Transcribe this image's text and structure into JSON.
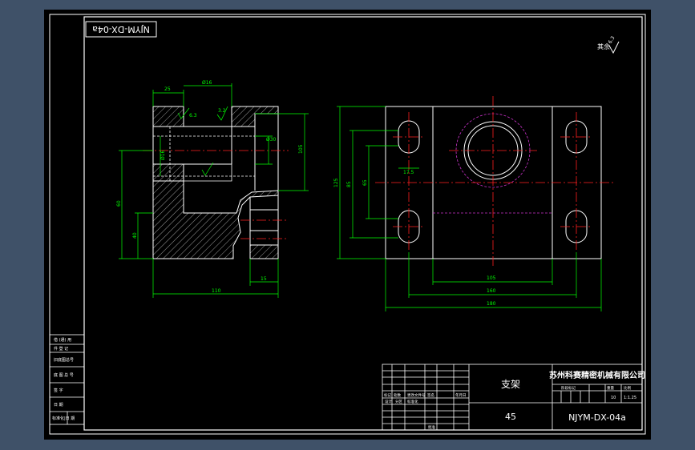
{
  "app": {
    "background_color": "#3f5168",
    "paper_color": "#000000"
  },
  "drawing": {
    "title_code_rotated": "NJYM-DX-04a",
    "roughness_note": "其余",
    "roughness_value": "6.3",
    "part_name": "支架",
    "material": "45",
    "company": "苏州科赛精密机械有限公司",
    "drawing_number": "NJYM-DX-04a",
    "scale_label": "比例",
    "scale": "1:1.25",
    "quantity": "10",
    "weight_label": "重量",
    "stage_label": "阶段标记",
    "sheet_label": "共  张  第  张"
  },
  "side_labels": [
    "借 (通) 用",
    "件 登 记",
    "旧底图总号",
    "底 图 总 号",
    "签  字",
    "日  期",
    "标准化|日 期"
  ],
  "title_block_labels": {
    "marks": "标记",
    "count": "处数",
    "zone": "分区",
    "change_doc": "更改文件号",
    "sign": "签名",
    "date": "年月日",
    "designer": "设计",
    "standardize": "标准化",
    "reviewer": "审核",
    "process": "工艺",
    "approve": "批准"
  },
  "dimensions": {
    "left_view": {
      "top_width": "25",
      "top_total": "Ø16",
      "roughness_a": "6.3",
      "roughness_b": "3.2",
      "hole_dia": "Ø30",
      "bore_dia": "Ø16",
      "right_height": "105",
      "left_height": "60",
      "lower_height": "40",
      "bottom_step": "15",
      "overall_width": "110"
    },
    "right_view": {
      "overall_height": "125",
      "inner_height": "85",
      "hole_spacing": "65",
      "slot_offset": "17.5",
      "center_width": "105",
      "hole_pitch": "160",
      "overall_width": "180"
    }
  },
  "colors": {
    "outline": "#ffffff",
    "dimension": "#00ff00",
    "centerline": "#ff2020",
    "hidden": "#ffffff",
    "hatch": "#ffffff",
    "phantom": "#cc33cc",
    "title_text": "#ffffff"
  }
}
